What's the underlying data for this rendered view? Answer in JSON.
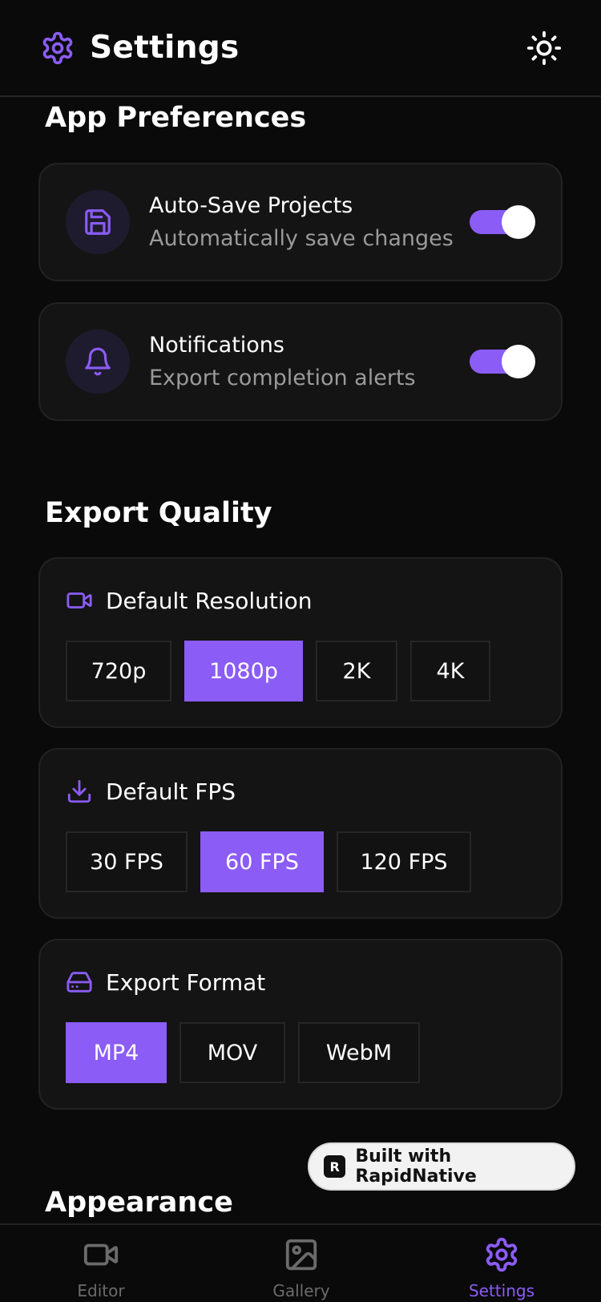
{
  "header": {
    "title": "Settings",
    "icon": "gear-icon",
    "theme_icon": "sun-icon"
  },
  "preferences": {
    "section_title": "App Preferences",
    "items": [
      {
        "title": "Auto-Save Projects",
        "subtitle": "Automatically save changes",
        "icon": "save-icon",
        "enabled": true
      },
      {
        "title": "Notifications",
        "subtitle": "Export completion alerts",
        "icon": "bell-icon",
        "enabled": true
      }
    ]
  },
  "export_quality": {
    "section_title": "Export Quality",
    "resolution": {
      "label": "Default Resolution",
      "icon": "video-icon",
      "options": [
        "720p",
        "1080p",
        "2K",
        "4K"
      ],
      "selected": "1080p"
    },
    "fps": {
      "label": "Default FPS",
      "icon": "download-icon",
      "options": [
        "30 FPS",
        "60 FPS",
        "120 FPS"
      ],
      "selected": "60 FPS"
    },
    "format": {
      "label": "Export Format",
      "icon": "hard-drive-icon",
      "options": [
        "MP4",
        "MOV",
        "WebM"
      ],
      "selected": "MP4"
    }
  },
  "appearance": {
    "section_title": "Appearance"
  },
  "badge": {
    "label": "Built with RapidNative",
    "logo_letter": "R"
  },
  "tabbar": {
    "tabs": [
      {
        "label": "Editor",
        "icon": "video-icon",
        "active": false
      },
      {
        "label": "Gallery",
        "icon": "image-icon",
        "active": false
      },
      {
        "label": "Settings",
        "icon": "gear-icon",
        "active": true
      }
    ]
  },
  "colors": {
    "accent": "#8b5cf6",
    "background": "#0a0a0a",
    "card": "#141414",
    "muted_text": "#9a9a9a"
  }
}
